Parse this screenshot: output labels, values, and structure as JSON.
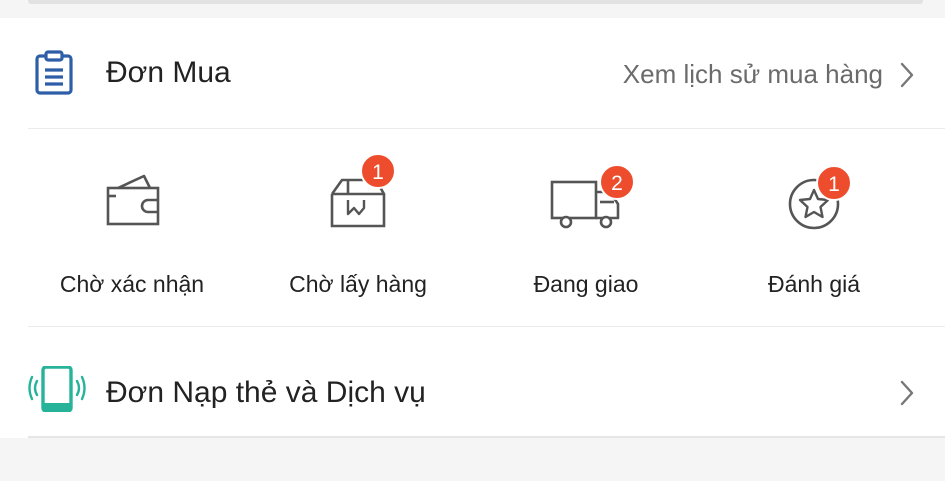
{
  "orders": {
    "title": "Đơn Mua",
    "history_link": "Xem lịch sử mua hàng"
  },
  "statuses": [
    {
      "label": "Chờ xác nhận",
      "icon": "wallet-icon",
      "badge": null
    },
    {
      "label": "Chờ lấy hàng",
      "icon": "box-icon",
      "badge": "1"
    },
    {
      "label": "Đang giao",
      "icon": "truck-icon",
      "badge": "2"
    },
    {
      "label": "Đánh giá",
      "icon": "star-icon",
      "badge": "1"
    }
  ],
  "services": {
    "title": "Đơn Nạp thẻ và Dịch vụ"
  },
  "colors": {
    "accent_blue": "#2e5ea8",
    "badge_red": "#ee4d2d",
    "phone_teal": "#26b39a"
  }
}
